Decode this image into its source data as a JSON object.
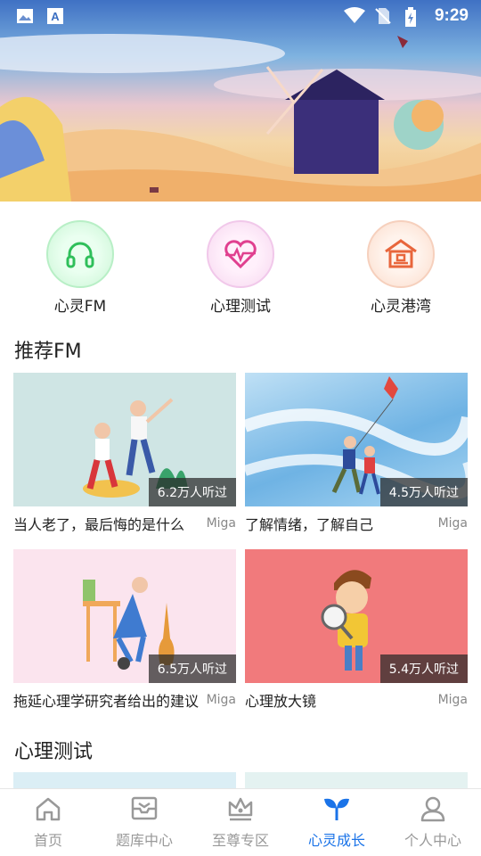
{
  "status_bar": {
    "time": "9:29",
    "left_icons": [
      "image-icon",
      "a-icon"
    ],
    "right_icons": [
      "wifi-icon",
      "no-sim-icon",
      "battery-icon"
    ]
  },
  "quick_entries": [
    {
      "label": "心灵FM",
      "icon": "headphones-icon",
      "color": "#2fbf5a"
    },
    {
      "label": "心理测试",
      "icon": "heart-pulse-icon",
      "color": "#e0408f"
    },
    {
      "label": "心灵港湾",
      "icon": "house-icon",
      "color": "#e8663c"
    }
  ],
  "recommend": {
    "title": "推荐FM",
    "items": [
      {
        "title": "当人老了，最后悔的是什么",
        "author": "Miga",
        "listens": "6.2万人听过"
      },
      {
        "title": "了解情绪，了解自己",
        "author": "Miga",
        "listens": "4.5万人听过"
      },
      {
        "title": "拖延心理学研究者给出的建议",
        "author": "Miga",
        "listens": "6.5万人听过"
      },
      {
        "title": "心理放大镜",
        "author": "Miga",
        "listens": "5.4万人听过"
      }
    ]
  },
  "tests": {
    "title": "心理测试"
  },
  "tabs": [
    {
      "label": "首页",
      "icon": "home-icon"
    },
    {
      "label": "题库中心",
      "icon": "inbox-icon"
    },
    {
      "label": "至尊专区",
      "icon": "crown-icon"
    },
    {
      "label": "心灵成长",
      "icon": "sprout-icon",
      "active": true
    },
    {
      "label": "个人中心",
      "icon": "person-icon"
    }
  ],
  "colors": {
    "accent": "#1a73e8",
    "inactive": "#999999"
  }
}
